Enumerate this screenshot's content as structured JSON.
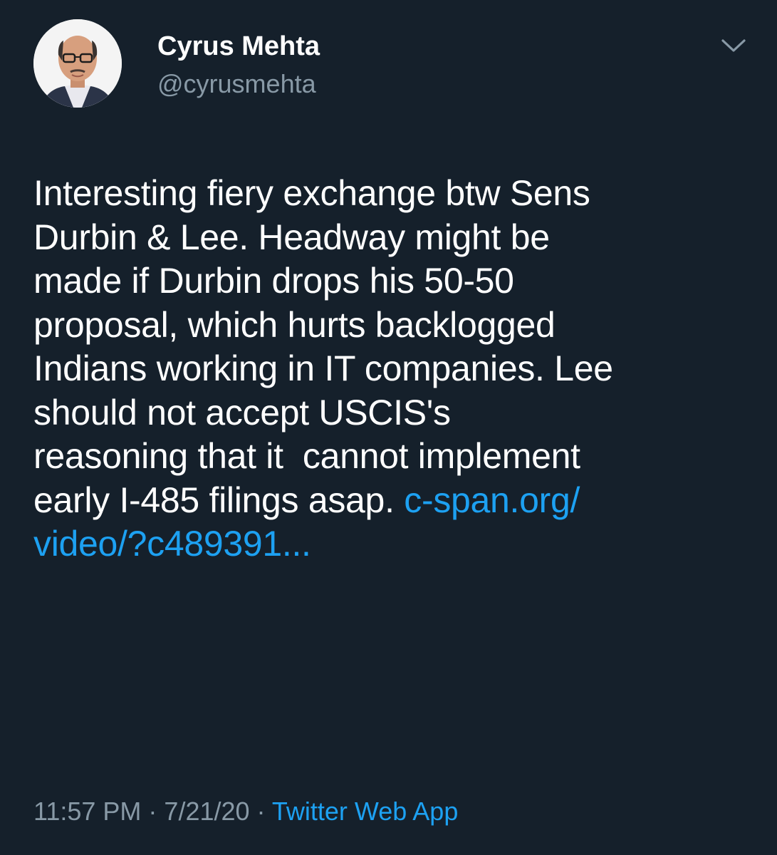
{
  "author": {
    "name": "Cyrus Mehta",
    "handle": "@cyrusmehta",
    "avatar_icon": "profile-photo"
  },
  "menu_icon": "chevron-down-icon",
  "tweet": {
    "lines": [
      "Interesting fiery exchange btw Sens",
      "Durbin & Lee. Headway might be",
      "made if Durbin drops his 50-50",
      "proposal, which hurts backlogged",
      "Indians working in IT companies. Lee",
      "should not accept USCIS's",
      "reasoning that it  cannot implement",
      "early I-485 filings asap. "
    ],
    "link_part1": "c-span.org/",
    "link_part2": "video/?c489391..."
  },
  "meta": {
    "time": "11:57 PM",
    "separator": " · ",
    "date": "7/21/20",
    "source": "Twitter Web App"
  },
  "colors": {
    "background": "#15202b",
    "text": "#ffffff",
    "secondary": "#8899a6",
    "link": "#1da1f2"
  }
}
